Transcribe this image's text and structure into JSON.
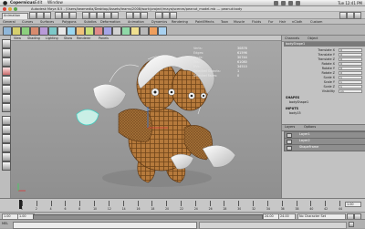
{
  "menubar": {
    "app_name": "Copernicus",
    "items": [
      "Edit",
      "Window"
    ],
    "clock": "Tue 12:41 PM"
  },
  "window": {
    "path": "Autodesk Maya 8.5 - /Users/beamedia/Desktop/Assets/teams/2008/work/project/maya/scenes/peanut_model.mb --- peanut:body"
  },
  "modebar": {
    "mode": "Animation"
  },
  "shelf_tabs": [
    "General",
    "Curves",
    "Surfaces",
    "Polygons",
    "Subdivs",
    "Deformation",
    "Animation",
    "Dynamics",
    "Rendering",
    "PaintEffects",
    "Toon",
    "Muscle",
    "Fluids",
    "Fur",
    "Hair",
    "nCloth",
    "Custom"
  ],
  "viewport_menu": [
    "View",
    "Shading",
    "Lighting",
    "Show",
    "Renderer",
    "Panels"
  ],
  "hud": {
    "rows": [
      {
        "label": "Verts:",
        "value": "30876"
      },
      {
        "label": "Edges:",
        "value": "61596"
      },
      {
        "label": "Faces:",
        "value": "30744"
      },
      {
        "label": "Tris:",
        "value": "61080"
      },
      {
        "label": "UVs:",
        "value": "34510"
      },
      {
        "label": "Selected Objects:",
        "value": "1"
      },
      {
        "label": "Selected Faces:",
        "value": "0"
      }
    ]
  },
  "channel_box": {
    "tabs": [
      "Channels",
      "Object"
    ],
    "selected_object": "bodyShape1",
    "channels": [
      {
        "name": "Translate X",
        "value": "0"
      },
      {
        "name": "Translate Y",
        "value": "0"
      },
      {
        "name": "Translate Z",
        "value": "0"
      },
      {
        "name": "Rotate X",
        "value": "0"
      },
      {
        "name": "Rotate Y",
        "value": "0"
      },
      {
        "name": "Rotate Z",
        "value": "0"
      },
      {
        "name": "Scale X",
        "value": "1"
      },
      {
        "name": "Scale Y",
        "value": "1"
      },
      {
        "name": "Scale Z",
        "value": "1"
      },
      {
        "name": "Visibility",
        "value": "on"
      }
    ],
    "shapes_label": "SHAPES",
    "shape_name": "bodyShape1",
    "inputs_label": "INPUTS",
    "input_name": "body15"
  },
  "layers": {
    "menu": [
      "Layers",
      "Options"
    ],
    "items": [
      "Layer1",
      "Layer2",
      "ShapeFrame"
    ]
  },
  "timeline": {
    "ticks": [
      "1",
      "2",
      "4",
      "6",
      "8",
      "10",
      "12",
      "14",
      "16",
      "18",
      "20",
      "22",
      "24",
      "26",
      "28",
      "30",
      "32",
      "34",
      "36",
      "38",
      "40",
      "42",
      "44"
    ],
    "current_frame": "1.00"
  },
  "range": {
    "start": "1.00",
    "end": "24.00",
    "character_set": "No Character Set"
  },
  "command": {
    "prefix": "MEL"
  },
  "colors": {
    "accent": "#7a7a7a",
    "viewport": "#9b9b9b",
    "selection_highlight": "#ffffff",
    "manipulator_blue": "#3b7bd8",
    "peanut_shell": "#b5783a"
  }
}
